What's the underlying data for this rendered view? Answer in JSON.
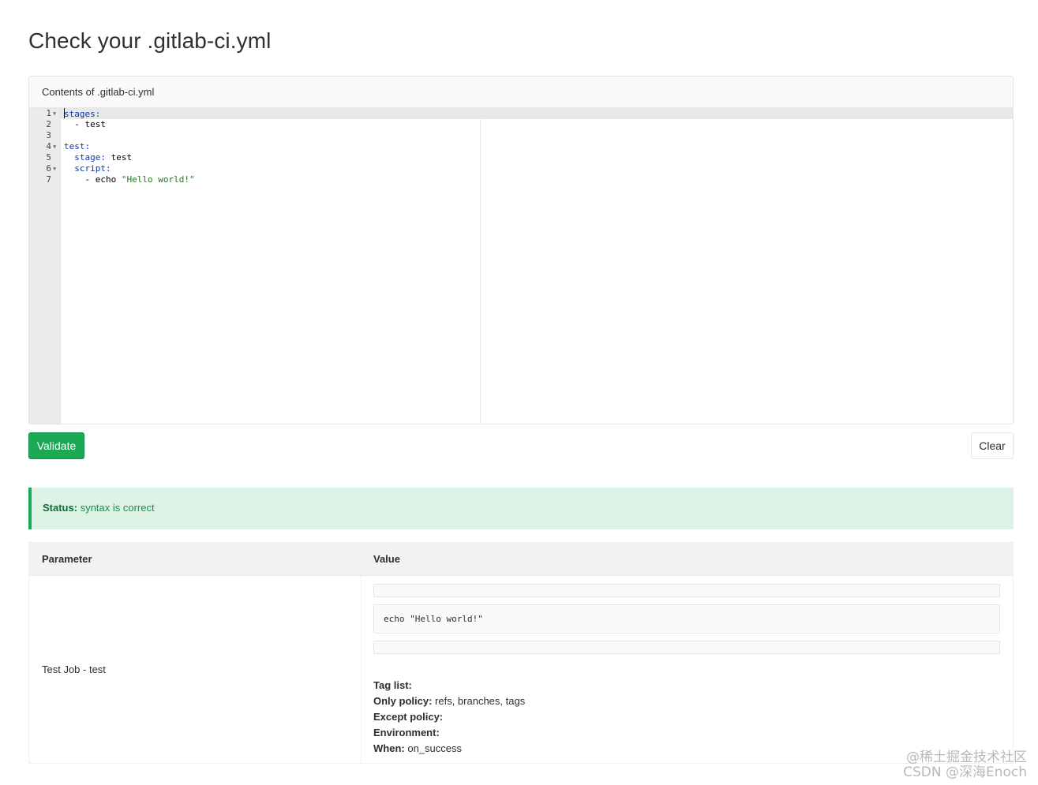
{
  "page": {
    "title": "Check your .gitlab-ci.yml"
  },
  "editor": {
    "header": "Contents of .gitlab-ci.yml",
    "lines": [
      {
        "num": "1",
        "fold": true,
        "tokens": [
          {
            "t": "stages:",
            "c": "key"
          }
        ]
      },
      {
        "num": "2",
        "fold": false,
        "tokens": [
          {
            "t": "  - test",
            "c": "plain"
          }
        ]
      },
      {
        "num": "3",
        "fold": false,
        "tokens": []
      },
      {
        "num": "4",
        "fold": true,
        "tokens": [
          {
            "t": "test:",
            "c": "key"
          }
        ]
      },
      {
        "num": "5",
        "fold": false,
        "tokens": [
          {
            "t": "  ",
            "c": "plain"
          },
          {
            "t": "stage:",
            "c": "key"
          },
          {
            "t": " test",
            "c": "plain"
          }
        ]
      },
      {
        "num": "6",
        "fold": true,
        "tokens": [
          {
            "t": "  ",
            "c": "plain"
          },
          {
            "t": "script:",
            "c": "key"
          }
        ]
      },
      {
        "num": "7",
        "fold": false,
        "tokens": [
          {
            "t": "    - echo ",
            "c": "plain"
          },
          {
            "t": "\"Hello world!\"",
            "c": "str"
          }
        ]
      }
    ]
  },
  "actions": {
    "validate": "Validate",
    "clear": "Clear"
  },
  "status": {
    "label": "Status:",
    "text": "syntax is correct"
  },
  "results": {
    "headers": {
      "parameter": "Parameter",
      "value": "Value"
    },
    "job": "Test Job - test",
    "script": "echo \"Hello world!\"",
    "meta": [
      {
        "label": "Tag list:",
        "value": ""
      },
      {
        "label": "Only policy:",
        "value": "refs, branches, tags"
      },
      {
        "label": "Except policy:",
        "value": ""
      },
      {
        "label": "Environment:",
        "value": ""
      },
      {
        "label": "When:",
        "value": "on_success"
      }
    ]
  },
  "watermark": {
    "line1": "@稀土掘金技术社区",
    "line2": "CSDN @深海Enoch"
  },
  "colors": {
    "accent": "#1aaa55",
    "status_bg": "#ddf3e6",
    "key_token": "#0b3aa8",
    "string_token": "#1a7a1a"
  }
}
